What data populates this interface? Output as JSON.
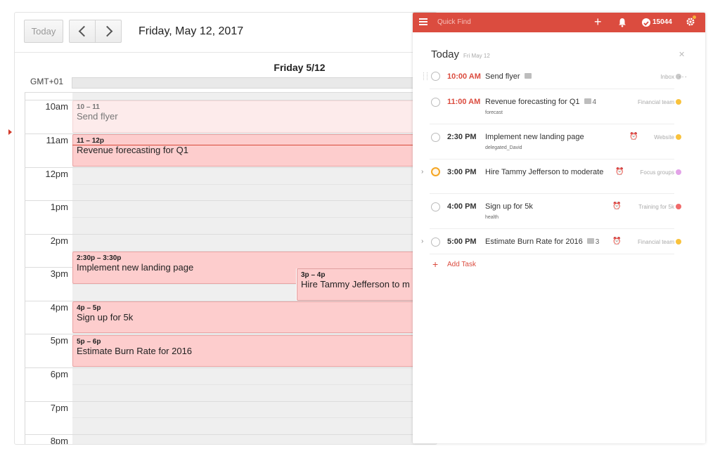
{
  "calendar": {
    "today_label": "Today",
    "date_title": "Friday, May 12, 2017",
    "day_header": "Friday 5/12",
    "timezone": "GMT+01",
    "hours": [
      "10am",
      "11am",
      "12pm",
      "1pm",
      "2pm",
      "3pm",
      "4pm",
      "5pm",
      "6pm",
      "7pm",
      "8pm"
    ],
    "events": [
      {
        "time": "10 – 11",
        "title": "Send flyer",
        "status": "past"
      },
      {
        "time": "11 – 12p",
        "title": "Revenue forecasting for Q1",
        "status": "current"
      },
      {
        "time": "2:30p – 3:30p",
        "title": "Implement new landing page",
        "status": "upcoming"
      },
      {
        "time": "3p – 4p",
        "title": "Hire Tammy Jefferson to m",
        "status": "upcoming"
      },
      {
        "time": "4p – 5p",
        "title": "Sign up for 5k",
        "status": "upcoming"
      },
      {
        "time": "5p – 6p",
        "title": "Estimate Burn Rate for 2016",
        "status": "upcoming"
      }
    ]
  },
  "todoist": {
    "quick_find": "Quick Find",
    "karma": "15044",
    "heading": "Today",
    "heading_sub": "Fri May 12",
    "add_task": "Add Task",
    "colors": {
      "brand": "#db4c3f",
      "orange": "#f5a623"
    },
    "tasks": [
      {
        "time": "10:00 AM",
        "name": "Send flyer",
        "label": "",
        "comments": "",
        "project": "Inbox",
        "dot": "#c8c8c8",
        "overdue": true,
        "alarm": false,
        "arrow": false
      },
      {
        "time": "11:00 AM",
        "name": "Revenue forecasting for Q1",
        "label": "forecast",
        "comments": "4",
        "project": "Financial team",
        "dot": "#f9c23c",
        "overdue": true,
        "alarm": false,
        "arrow": false
      },
      {
        "time": "2:30 PM",
        "name": "Implement new landing page",
        "label": "delegated_David",
        "comments": "",
        "project": "Website",
        "dot": "#f9c23c",
        "overdue": false,
        "alarm": true,
        "arrow": false
      },
      {
        "time": "3:00 PM",
        "name": "Hire Tammy Jefferson to moderate",
        "label": "",
        "comments": "",
        "project": "Focus groups",
        "dot": "#e3a3e8",
        "overdue": false,
        "alarm": true,
        "arrow": true
      },
      {
        "time": "4:00 PM",
        "name": "Sign up for 5k",
        "label": "health",
        "comments": "",
        "project": "Training for 5k",
        "dot": "#f06a6a",
        "overdue": false,
        "alarm": true,
        "arrow": false
      },
      {
        "time": "5:00 PM",
        "name": "Estimate Burn Rate for 2016",
        "label": "",
        "comments": "3",
        "project": "Financial team",
        "dot": "#f9c23c",
        "overdue": false,
        "alarm": true,
        "arrow": true
      }
    ]
  }
}
